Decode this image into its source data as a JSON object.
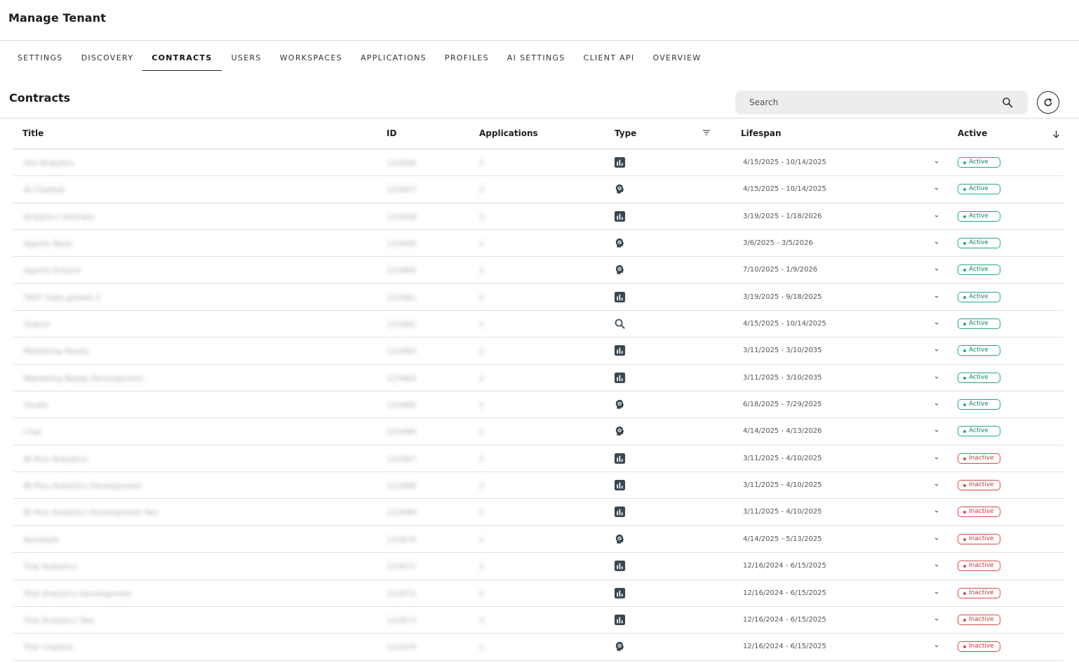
{
  "header": {
    "title": "Manage Tenant"
  },
  "tabs": [
    {
      "label": "SETTINGS",
      "active": false
    },
    {
      "label": "DISCOVERY",
      "active": false
    },
    {
      "label": "CONTRACTS",
      "active": true
    },
    {
      "label": "USERS",
      "active": false
    },
    {
      "label": "WORKSPACES",
      "active": false
    },
    {
      "label": "APPLICATIONS",
      "active": false
    },
    {
      "label": "PROFILES",
      "active": false
    },
    {
      "label": "AI SETTINGS",
      "active": false
    },
    {
      "label": "CLIENT API",
      "active": false
    },
    {
      "label": "OVERVIEW",
      "active": false
    }
  ],
  "section": {
    "title": "Contracts"
  },
  "search": {
    "placeholder": "Search"
  },
  "table": {
    "columns": {
      "title": "Title",
      "id": "ID",
      "applications": "Applications",
      "type": "Type",
      "lifespan": "Lifespan",
      "active": "Active"
    },
    "rows": [
      {
        "title": "Old Analytics",
        "id": "123456",
        "apps": "1",
        "type": "chart-icon",
        "lifespan": "4/15/2025 - 10/14/2025",
        "status": "Active"
      },
      {
        "title": "AI Chatbot",
        "id": "123457",
        "apps": "2",
        "type": "ai-head-icon",
        "lifespan": "4/15/2025 - 10/14/2025",
        "status": "Active"
      },
      {
        "title": "Analytics Ultimate",
        "id": "123458",
        "apps": "3",
        "type": "chart-icon",
        "lifespan": "3/19/2025 - 1/18/2026",
        "status": "Active"
      },
      {
        "title": "Agents Basic",
        "id": "123459",
        "apps": "1",
        "type": "ai-head-icon",
        "lifespan": "3/6/2025 - 3/5/2026",
        "status": "Active"
      },
      {
        "title": "Agents Extend",
        "id": "123460",
        "apps": "1",
        "type": "ai-head-icon",
        "lifespan": "7/10/2025 - 1/9/2026",
        "status": "Active"
      },
      {
        "title": "TEST Data growth 2",
        "id": "123461",
        "apps": "2",
        "type": "chart-icon",
        "lifespan": "3/19/2025 - 9/18/2025",
        "status": "Active"
      },
      {
        "title": "Search",
        "id": "123462",
        "apps": "1",
        "type": "search-type-icon",
        "lifespan": "4/15/2025 - 10/14/2025",
        "status": "Active"
      },
      {
        "title": "Marketing Ready",
        "id": "123463",
        "apps": "2",
        "type": "chart-icon",
        "lifespan": "3/11/2025 - 3/10/2035",
        "status": "Active"
      },
      {
        "title": "Marketing Ready Development",
        "id": "123464",
        "apps": "2",
        "type": "chart-icon",
        "lifespan": "3/11/2025 - 3/10/2035",
        "status": "Active"
      },
      {
        "title": "Studio",
        "id": "123465",
        "apps": "1",
        "type": "ai-head-icon",
        "lifespan": "6/18/2025 - 7/29/2025",
        "status": "Active"
      },
      {
        "title": "Chat",
        "id": "123466",
        "apps": "1",
        "type": "ai-head-icon",
        "lifespan": "4/14/2025 - 4/13/2026",
        "status": "Active"
      },
      {
        "title": "BI Plus Analytics",
        "id": "123467",
        "apps": "1",
        "type": "chart-icon",
        "lifespan": "3/11/2025 - 4/10/2025",
        "status": "Inactive"
      },
      {
        "title": "BI Plus Analytics Development",
        "id": "123468",
        "apps": "2",
        "type": "chart-icon",
        "lifespan": "3/11/2025 - 4/10/2025",
        "status": "Inactive"
      },
      {
        "title": "BI Plus Analytics Development Two",
        "id": "123469",
        "apps": "2",
        "type": "chart-icon",
        "lifespan": "3/11/2025 - 4/10/2025",
        "status": "Inactive"
      },
      {
        "title": "Assistant",
        "id": "123470",
        "apps": "1",
        "type": "ai-head-icon",
        "lifespan": "4/14/2025 - 5/13/2025",
        "status": "Inactive"
      },
      {
        "title": "Trial Analytics",
        "id": "123471",
        "apps": "1",
        "type": "chart-icon",
        "lifespan": "12/16/2024 - 6/15/2025",
        "status": "Inactive"
      },
      {
        "title": "Trial Analytics Development",
        "id": "123472",
        "apps": "2",
        "type": "chart-icon",
        "lifespan": "12/16/2024 - 6/15/2025",
        "status": "Inactive"
      },
      {
        "title": "Trial Analytics Two",
        "id": "123473",
        "apps": "2",
        "type": "chart-icon",
        "lifespan": "12/16/2024 - 6/15/2025",
        "status": "Inactive"
      },
      {
        "title": "Trial Chatbot",
        "id": "123474",
        "apps": "1",
        "type": "ai-head-icon",
        "lifespan": "12/16/2024 - 6/15/2025",
        "status": "Inactive"
      }
    ]
  },
  "colors": {
    "active": "#22a884",
    "inactive": "#d94a4a",
    "icon": "#3a4750"
  }
}
